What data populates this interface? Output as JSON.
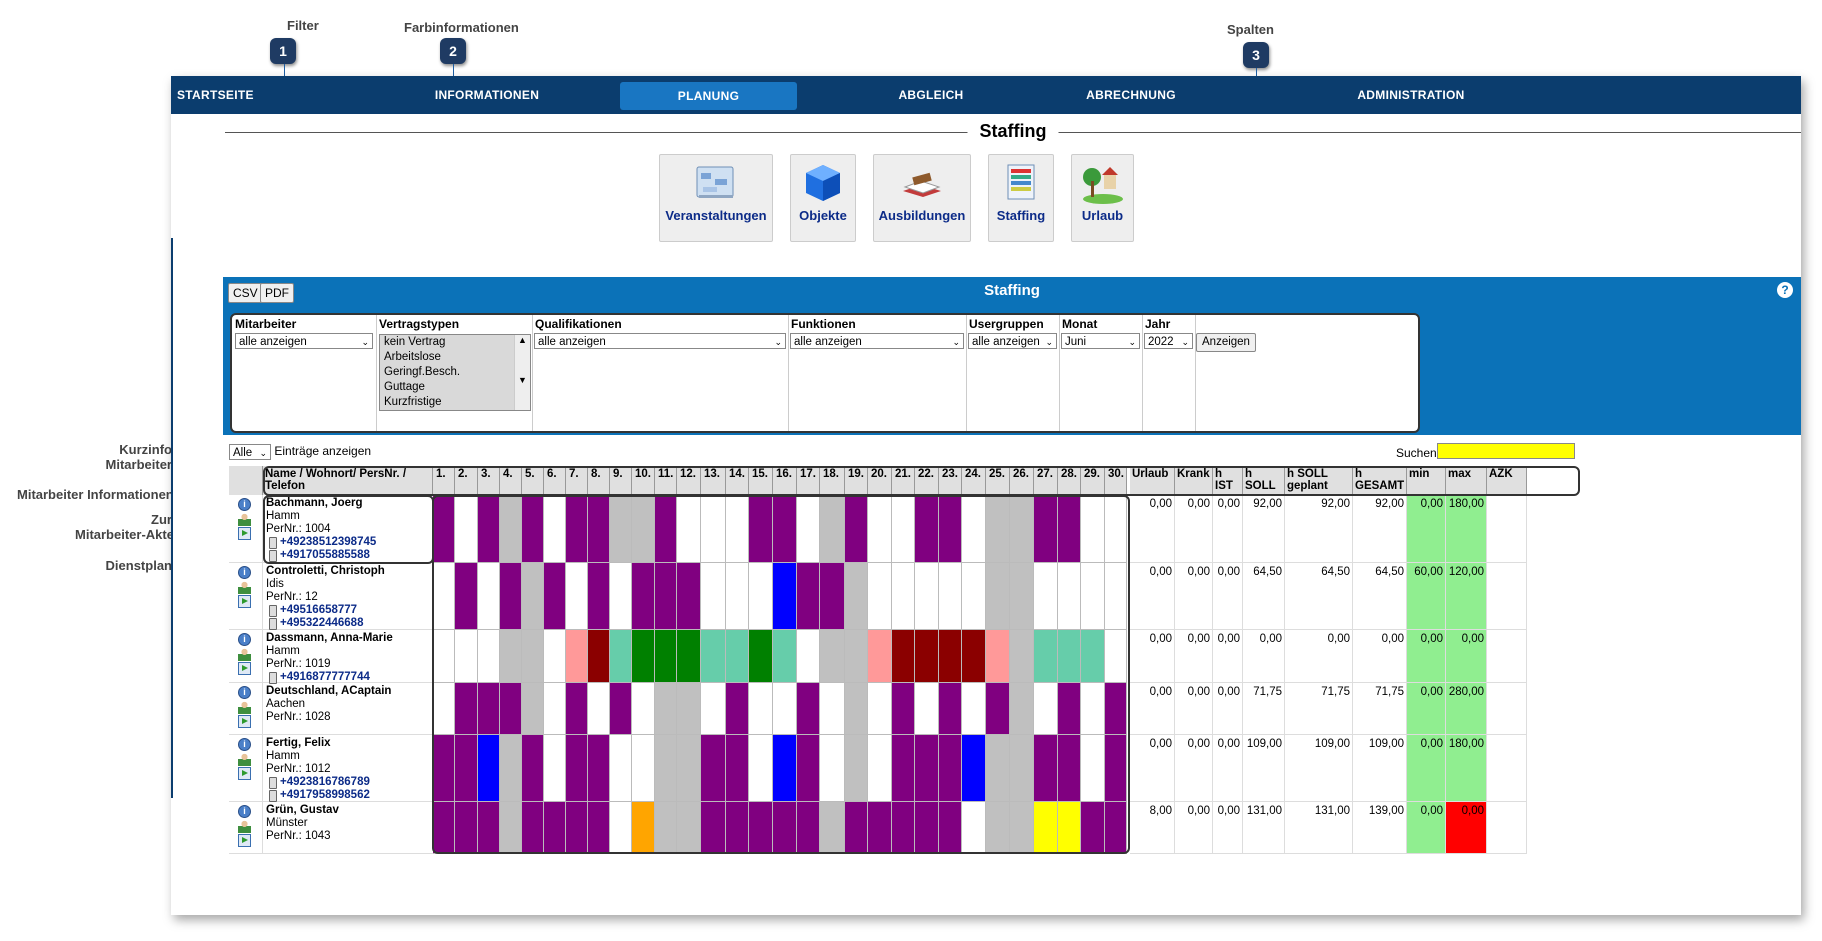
{
  "callouts": [
    {
      "id": "1",
      "label": "Filter"
    },
    {
      "id": "2",
      "label": "Farbinformationen"
    },
    {
      "id": "3",
      "label": "Spalten"
    },
    {
      "id": "4",
      "label": "Kurzinfo\nMitarbeiter"
    },
    {
      "id": "5",
      "label": "Mitarbeiter Informationen"
    },
    {
      "id": "6",
      "label": "Zur\nMitarbeiter-Akte"
    },
    {
      "id": "7",
      "label": "Dienstplan"
    }
  ],
  "nav": {
    "items": [
      {
        "label": "STARTSEITE",
        "active": false
      },
      {
        "label": "INFORMATIONEN",
        "active": false
      },
      {
        "label": "PLANUNG",
        "active": true
      },
      {
        "label": "ABGLEICH",
        "active": false
      },
      {
        "label": "ABRECHNUNG",
        "active": false
      },
      {
        "label": "ADMINISTRATION",
        "active": false
      }
    ]
  },
  "page_title": "Staffing",
  "tiles": [
    {
      "label": "Veranstaltungen",
      "icon": "events-icon"
    },
    {
      "label": "Objekte",
      "icon": "cube-icon"
    },
    {
      "label": "Ausbildungen",
      "icon": "books-icon"
    },
    {
      "label": "Staffing",
      "icon": "staffing-icon"
    },
    {
      "label": "Urlaub",
      "icon": "vacation-icon"
    }
  ],
  "panel": {
    "title": "Staffing",
    "export_buttons": [
      "CSV",
      "PDF"
    ],
    "help_icon": "help-icon"
  },
  "filters": {
    "mitarbeiter": {
      "label": "Mitarbeiter",
      "value": "alle anzeigen"
    },
    "vertragstypen": {
      "label": "Vertragstypen",
      "options": [
        "kein Vertrag",
        "Arbeitslose",
        "Geringf.Besch.",
        "Guttage",
        "Kurzfristige Beschäftigung"
      ]
    },
    "qualifikationen": {
      "label": "Qualifikationen",
      "value": "alle anzeigen"
    },
    "funktionen": {
      "label": "Funktionen",
      "value": "alle anzeigen"
    },
    "usergruppen": {
      "label": "Usergruppen",
      "value": "alle anzeigen"
    },
    "monat": {
      "label": "Monat",
      "value": "Juni"
    },
    "jahr": {
      "label": "Jahr",
      "value": "2022"
    },
    "show_button": "Anzeigen"
  },
  "entries": {
    "value": "Alle",
    "suffix": "Einträge anzeigen"
  },
  "search": {
    "label": "Suchen",
    "value": ""
  },
  "table": {
    "name_header": "Name / Wohnort/ PersNr. / Telefon",
    "day_headers": [
      "1.",
      "2.",
      "3.",
      "4.",
      "5.",
      "6.",
      "7.",
      "8.",
      "9.",
      "10.",
      "11.",
      "12.",
      "13.",
      "14.",
      "15.",
      "16.",
      "17.",
      "18.",
      "19.",
      "20.",
      "21.",
      "22.",
      "23.",
      "24.",
      "25.",
      "26.",
      "27.",
      "28.",
      "29.",
      "30."
    ],
    "stat_headers": [
      "Urlaub",
      "Krank",
      "h IST",
      "h SOLL",
      "h SOLL geplant",
      "h GESAMT",
      "min",
      "max",
      "AZK"
    ],
    "colors": {
      "P": "#800080",
      "W": "#ffffff",
      "G": "#c0c0c0",
      "B": "#0000ff",
      "S": "#ff9999",
      "R": "#8b0000",
      "T": "#66cdaa",
      "D": "#008000",
      "O": "#ffa500",
      "Y": "#ffff00",
      "green_bg": "#90ee90",
      "red_bg": "#ff0000"
    },
    "rows": [
      {
        "name": "Bachmann, Joerg",
        "city": "Hamm",
        "persnr": "PerNr.: 1004",
        "phones": [
          "+4923851239874​5",
          "+4917055885588"
        ],
        "days": "PWPGPWPPGGPWWWPPWGPWWPPWGGPPWW",
        "stats": [
          "0,00",
          "0,00",
          "0,00",
          "92,00",
          "92,00",
          "92,00",
          "0,00",
          "180,00",
          ""
        ],
        "min_state": "green",
        "max_state": "green"
      },
      {
        "name": "Controletti, Christoph",
        "city": "Idis",
        "persnr": "PerNr.: 12",
        "phones": [
          "+49516658777",
          "+495322446688"
        ],
        "days": "WPWPGPWPWPPPWWWBPPGWWWWWGGWWWW",
        "stats": [
          "0,00",
          "0,00",
          "0,00",
          "64,50",
          "64,50",
          "64,50",
          "60,00",
          "120,00",
          ""
        ],
        "min_state": "green",
        "max_state": "green"
      },
      {
        "name": "Dassmann, Anna-Marie",
        "city": "Hamm",
        "persnr": "PerNr.: 1019",
        "phones": [
          "+4916877777744"
        ],
        "days": "WWWGGWSRTDDDTTDTWGGSRRRRSGTTTW",
        "stats": [
          "0,00",
          "0,00",
          "0,00",
          "0,00",
          "0,00",
          "0,00",
          "0,00",
          "0,00",
          ""
        ],
        "min_state": "green",
        "max_state": "green"
      },
      {
        "name": "Deutschland, ACaptain",
        "city": "Aachen",
        "persnr": "PerNr.: 1028",
        "phones": [],
        "days": "WPPPGWPWPWGGWPWWPWGWPWPWPGWPWP",
        "stats": [
          "0,00",
          "0,00",
          "0,00",
          "71,75",
          "71,75",
          "71,75",
          "0,00",
          "280,00",
          ""
        ],
        "min_state": "green",
        "max_state": "green"
      },
      {
        "name": "Fertig, Felix",
        "city": "Hamm",
        "persnr": "PerNr.: 1012",
        "phones": [
          "+4923816786789",
          "+4917958998562"
        ],
        "days": "PPBGPWPPWWGGPPWBPWGWPPPBGGPPWP",
        "stats": [
          "0,00",
          "0,00",
          "0,00",
          "109,00",
          "109,00",
          "109,00",
          "0,00",
          "180,00",
          ""
        ],
        "min_state": "green",
        "max_state": "green"
      },
      {
        "name": "Grün, Gustav",
        "city": "Münster",
        "persnr": "PerNr.: 1043",
        "phones": [],
        "days": "PPPGPPPPWOGGPPPPPGPPPPPWGGYYPP",
        "stats": [
          "8,00",
          "0,00",
          "0,00",
          "131,00",
          "131,00",
          "139,00",
          "0,00",
          "0,00",
          ""
        ],
        "min_state": "green",
        "max_state": "red"
      }
    ]
  }
}
